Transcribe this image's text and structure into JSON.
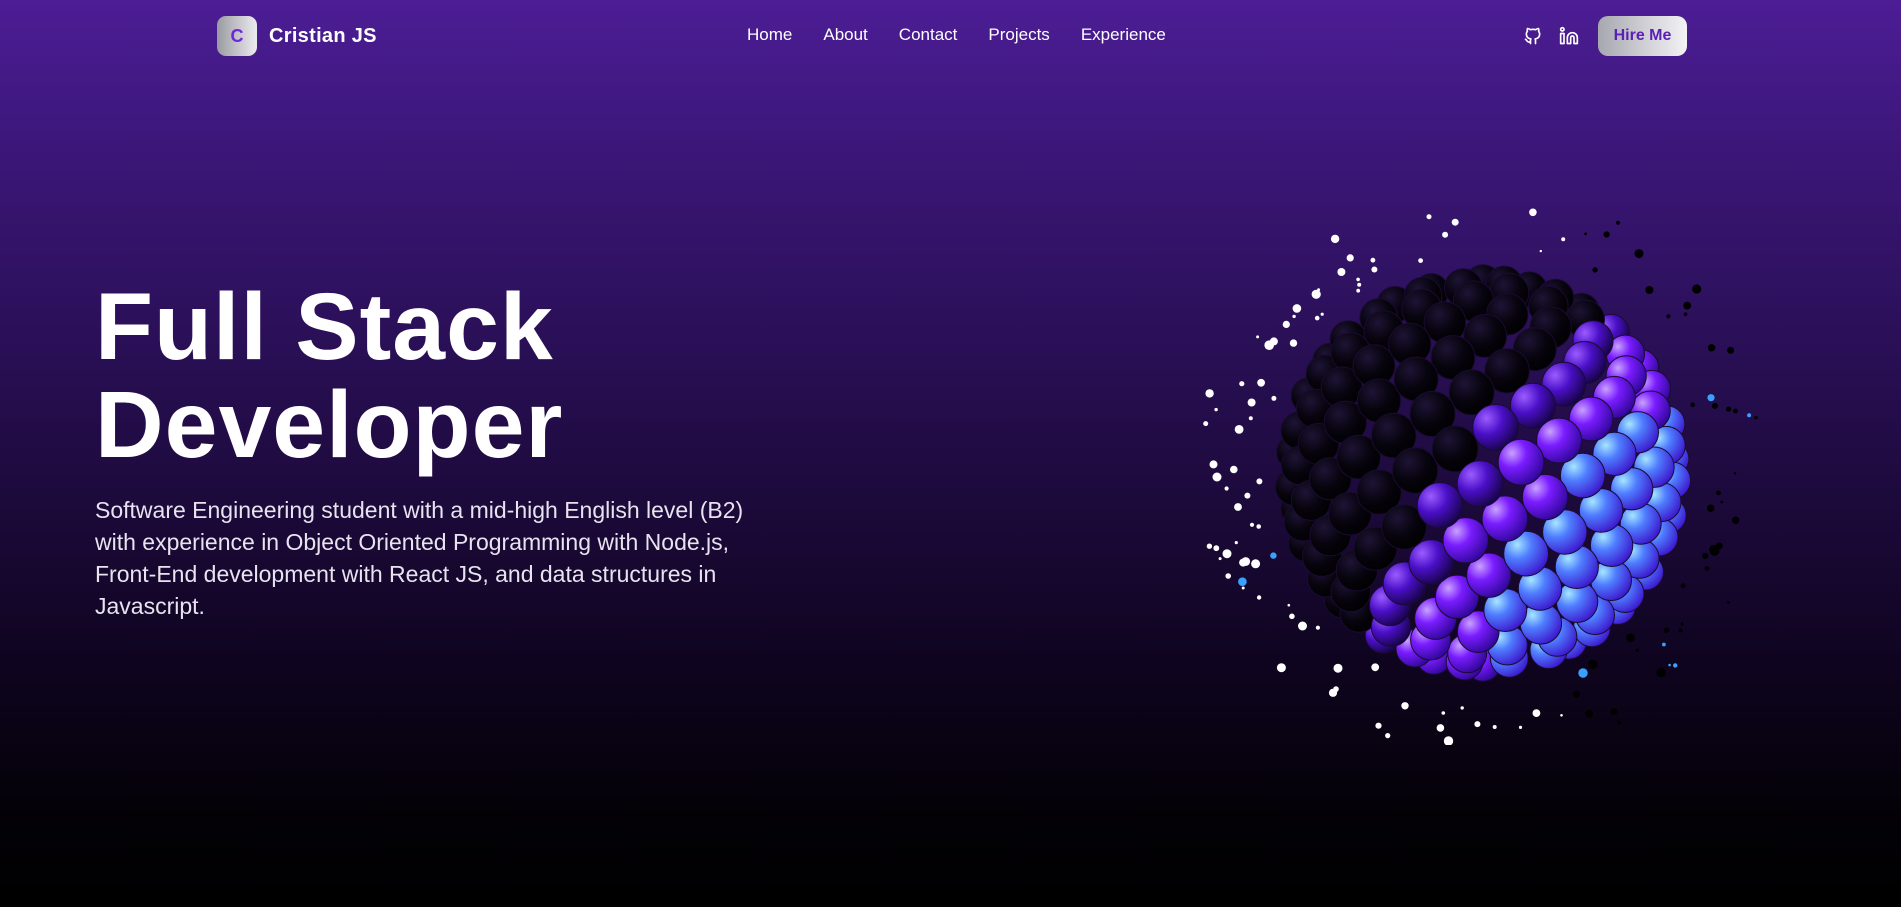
{
  "brand": {
    "initial": "C",
    "name": "Cristian JS"
  },
  "nav": {
    "links": [
      "Home",
      "About",
      "Contact",
      "Projects",
      "Experience"
    ],
    "hire_label": "Hire Me",
    "social_icons": [
      "github-icon",
      "linkedin-icon"
    ]
  },
  "hero": {
    "title_line1": "Full Stack",
    "title_line2": "Developer",
    "description": "Software Engineering student with a mid-high English level (B2) with experience in Object Oriented Programming with Node.js, Front-End development with React JS, and data structures in Javascript."
  },
  "colors": {
    "accent": "#6d28d9",
    "sphere_glow": "#6a00ff",
    "sphere_highlight": "#38bdf8",
    "background_top": "#4c1d95",
    "background_bottom": "#000000"
  }
}
